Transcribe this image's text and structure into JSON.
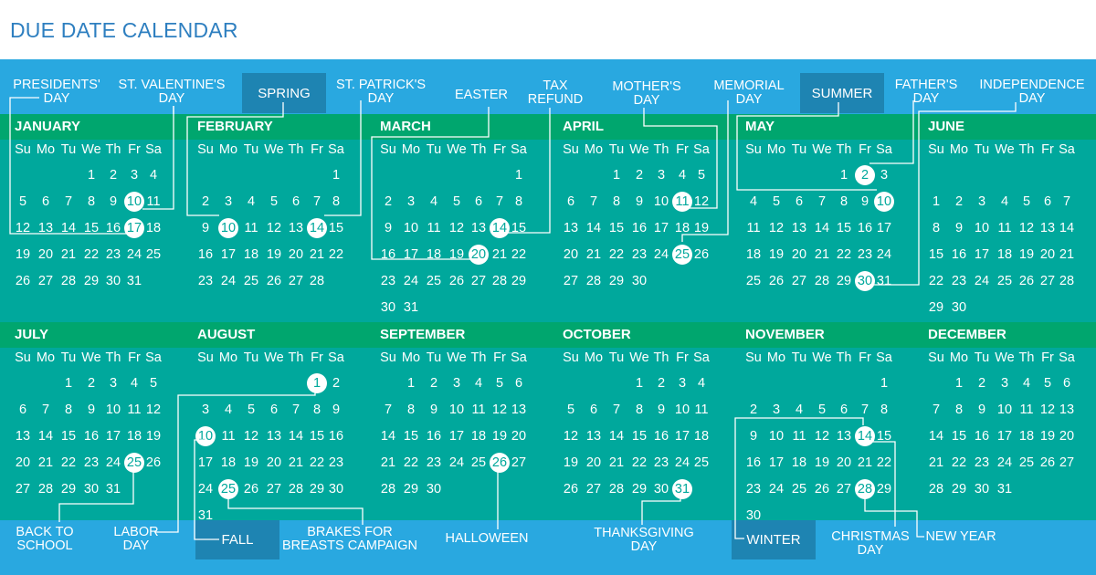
{
  "title": "DUE DATE CALENDAR",
  "colors": {
    "title": "#2e7fc0",
    "band_blue": "#29a8e0",
    "season_box": "#1e84b2",
    "month_band": "#00a66e",
    "calendar_body": "#00a89c",
    "text": "#ffffff"
  },
  "weekdays": [
    "Su",
    "Mo",
    "Tu",
    "We",
    "Th",
    "Fr",
    "Sa"
  ],
  "top_labels": [
    {
      "id": "presidents-day",
      "lines": [
        "PRESIDENTS'",
        "DAY"
      ]
    },
    {
      "id": "valentines-day",
      "lines": [
        "ST. VALENTINE'S",
        "DAY"
      ]
    },
    {
      "id": "spring",
      "lines": [
        "SPRING"
      ],
      "season": true
    },
    {
      "id": "st-patricks-day",
      "lines": [
        "ST. PATRICK'S",
        "DAY"
      ]
    },
    {
      "id": "easter",
      "lines": [
        "EASTER"
      ]
    },
    {
      "id": "tax-refund",
      "lines": [
        "TAX",
        "REFUND"
      ]
    },
    {
      "id": "mothers-day",
      "lines": [
        "MOTHER'S",
        "DAY"
      ]
    },
    {
      "id": "memorial-day",
      "lines": [
        "MEMORIAL",
        "DAY"
      ]
    },
    {
      "id": "summer",
      "lines": [
        "SUMMER"
      ],
      "season": true
    },
    {
      "id": "fathers-day",
      "lines": [
        "FATHER'S",
        "DAY"
      ]
    },
    {
      "id": "independence-day",
      "lines": [
        "INDEPENDENCE",
        "DAY"
      ]
    }
  ],
  "bottom_labels": [
    {
      "id": "back-to-school",
      "lines": [
        "BACK TO",
        "SCHOOL"
      ]
    },
    {
      "id": "labor-day",
      "lines": [
        "LABOR",
        "DAY"
      ]
    },
    {
      "id": "fall",
      "lines": [
        "FALL"
      ],
      "season": true
    },
    {
      "id": "brakes-for-breasts",
      "lines": [
        "BRAKES FOR",
        "BREASTS CAMPAIGN"
      ]
    },
    {
      "id": "halloween",
      "lines": [
        "HALLOWEEN"
      ]
    },
    {
      "id": "thanksgiving-day",
      "lines": [
        "THANKSGIVING",
        "DAY"
      ]
    },
    {
      "id": "winter",
      "lines": [
        "WINTER"
      ],
      "season": true
    },
    {
      "id": "christmas-day",
      "lines": [
        "CHRISTMAS",
        "DAY"
      ]
    },
    {
      "id": "new-year",
      "lines": [
        "NEW YEAR"
      ]
    }
  ],
  "months": [
    {
      "name": "JANUARY",
      "start": 3,
      "days": 31,
      "highlight": [
        10,
        17
      ]
    },
    {
      "name": "FEBRUARY",
      "start": 6,
      "days": 28,
      "highlight": [
        10,
        14
      ]
    },
    {
      "name": "MARCH",
      "start": 6,
      "days": 31,
      "highlight": [
        14,
        20
      ]
    },
    {
      "name": "APRIL",
      "start": 2,
      "days": 30,
      "highlight": [
        11,
        25
      ]
    },
    {
      "name": "MAY",
      "start": 4,
      "days": 31,
      "highlight": [
        2,
        10,
        30
      ]
    },
    {
      "name": "JUNE",
      "start": 0,
      "days": 30,
      "highlight": [],
      "empty_first_row": true
    },
    {
      "name": "JULY",
      "start": 2,
      "days": 31,
      "highlight": [
        25
      ]
    },
    {
      "name": "AUGUST",
      "start": 5,
      "days": 31,
      "highlight": [
        1,
        10,
        25
      ]
    },
    {
      "name": "SEPTEMBER",
      "start": 1,
      "days": 30,
      "highlight": [
        26
      ]
    },
    {
      "name": "OCTOBER",
      "start": 3,
      "days": 31,
      "highlight": [
        31
      ]
    },
    {
      "name": "NOVEMBER",
      "start": 6,
      "days": 30,
      "highlight": [
        14,
        28
      ]
    },
    {
      "name": "DECEMBER",
      "start": 1,
      "days": 31,
      "highlight": []
    }
  ]
}
